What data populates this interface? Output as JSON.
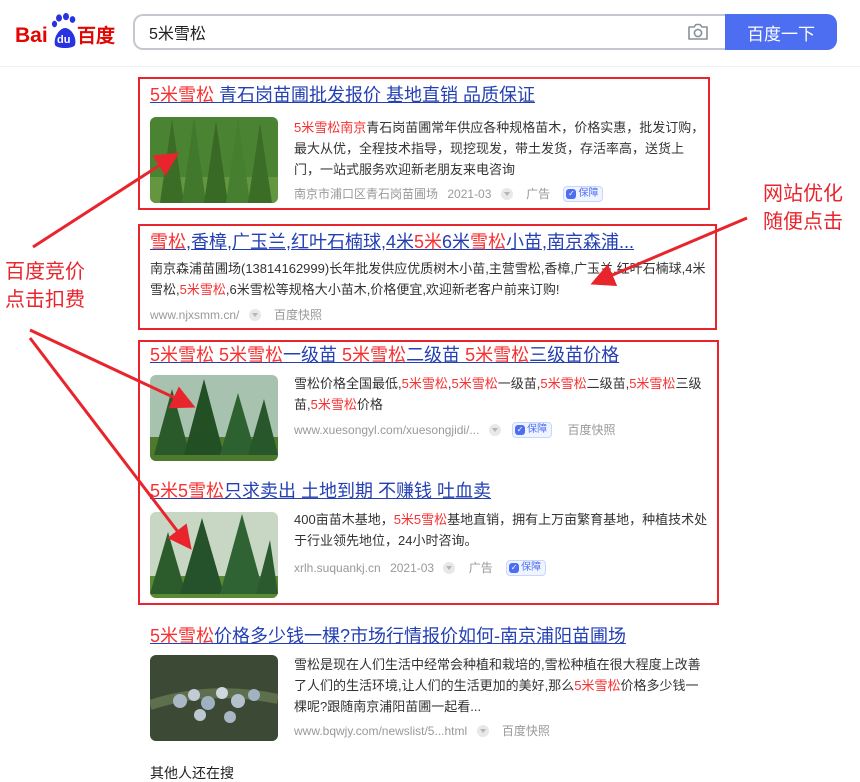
{
  "header": {
    "logo_text_left": "Bai",
    "logo_paw": "du",
    "logo_text_right": "百度",
    "search_query": "5米雪松",
    "search_button": "百度一下"
  },
  "results": [
    {
      "title_parts": [
        {
          "t": "5米雪松",
          "hl": true
        },
        {
          "t": "  青石岗苗圃批发报价  基地直销  品质保证",
          "hl": false
        }
      ],
      "desc_parts": [
        {
          "t": "5米雪松南京",
          "hl": true
        },
        {
          "t": "青石岗苗圃常年供应各种规格苗木，价格实惠，批发订购，最大从优，全程技术指导，现挖现发，带土发货，存活率高，送货上门，一站式服务欢迎新老朋友来电咨询",
          "hl": false
        }
      ],
      "source": "南京市浦口区青石岗苗圃场",
      "date": "2021-03",
      "ad_label": "广告",
      "badge": "保障"
    },
    {
      "title_parts": [
        {
          "t": "雪松",
          "hl": true
        },
        {
          "t": ",香樟,广玉兰,红叶石楠球,4米",
          "hl": false
        },
        {
          "t": "5米",
          "hl": true
        },
        {
          "t": "6米",
          "hl": false
        },
        {
          "t": "雪松",
          "hl": true
        },
        {
          "t": "小苗,南京森浦...",
          "hl": false
        }
      ],
      "desc_parts": [
        {
          "t": "南京森浦苗圃场(13814162999)长年批发供应优质树木小苗,主营雪松,香樟,广玉兰,红叶石楠球,4米雪松,",
          "hl": false
        },
        {
          "t": "5米雪松",
          "hl": true
        },
        {
          "t": ",6米雪松等规格大小苗木,价格便宜,欢迎新老客户前来订购!",
          "hl": false
        }
      ],
      "url": "www.njxsmm.cn/",
      "snapshot": "百度快照"
    },
    {
      "title_parts": [
        {
          "t": "5米雪松 5米雪松",
          "hl": true
        },
        {
          "t": "一级苗 ",
          "hl": false
        },
        {
          "t": "5米雪松",
          "hl": true
        },
        {
          "t": "二级苗 ",
          "hl": false
        },
        {
          "t": "5米雪松",
          "hl": true
        },
        {
          "t": "三级苗价格",
          "hl": false
        }
      ],
      "desc_parts": [
        {
          "t": "雪松价格全国最低,",
          "hl": false
        },
        {
          "t": "5米雪松",
          "hl": true
        },
        {
          "t": ",",
          "hl": false
        },
        {
          "t": "5米雪松",
          "hl": true
        },
        {
          "t": "一级苗,",
          "hl": false
        },
        {
          "t": "5米雪松",
          "hl": true
        },
        {
          "t": "二级苗,",
          "hl": false
        },
        {
          "t": "5米雪松",
          "hl": true
        },
        {
          "t": "三级苗,",
          "hl": false
        },
        {
          "t": "5米雪松",
          "hl": true
        },
        {
          "t": "价格",
          "hl": false
        }
      ],
      "url": "www.xuesongyl.com/xuesongjidi/...",
      "badge": "保障",
      "snapshot": "百度快照"
    },
    {
      "title_parts": [
        {
          "t": "5米5雪松",
          "hl": true
        },
        {
          "t": "只求卖出  土地到期  不赚钱  吐血卖",
          "hl": false
        }
      ],
      "desc_parts": [
        {
          "t": "400亩苗木基地，",
          "hl": false
        },
        {
          "t": "5米5雪松",
          "hl": true
        },
        {
          "t": "基地直销，拥有上万亩繁育基地，种植技术处于行业领先地位，24小时咨询。",
          "hl": false
        }
      ],
      "source": "xrlh.suquankj.cn",
      "date": "2021-03",
      "ad_label": "广告",
      "badge": "保障"
    },
    {
      "title_parts": [
        {
          "t": "5米雪松",
          "hl": true
        },
        {
          "t": "价格多少钱一棵?市场行情报价如何-南京浦阳苗圃场",
          "hl": false
        }
      ],
      "desc_parts": [
        {
          "t": "雪松是现在人们生活中经常会种植和栽培的,雪松种植在很大程度上改善了人们的生活环境,让人们的生活更加的美好,那么",
          "hl": false
        },
        {
          "t": "5米雪松",
          "hl": true
        },
        {
          "t": "价格多少钱一棵呢?跟随南京浦阳苗圃一起看...",
          "hl": false
        }
      ],
      "url": "www.bqwjy.com/newslist/5...html",
      "snapshot": "百度快照"
    }
  ],
  "footer_partial": "其他人还在搜",
  "annotations": {
    "left_line1": "百度竞价",
    "left_line2": "点击扣费",
    "right_line1": "网站优化",
    "right_line2": "随便点击"
  },
  "colors": {
    "brand_blue": "#4e6ef2",
    "title_blue": "#2440b3",
    "highlight_red": "#f73131",
    "annotation_red": "#e8242c"
  }
}
